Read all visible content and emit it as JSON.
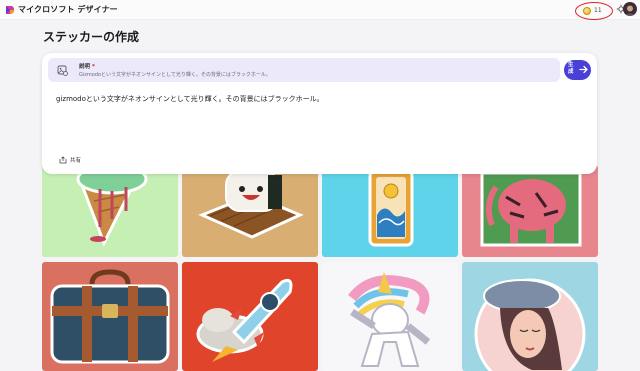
{
  "app": {
    "title": "マイクロソフト デザイナー"
  },
  "header": {
    "coin_count": "11"
  },
  "page": {
    "title": "ステッカーの作成"
  },
  "description": {
    "label": "説明",
    "required_mark": "*",
    "preview": "Gizmodoという文字がネオンサインとして光り輝く。その背景にはブラックホール。",
    "prompt": "gizmodoという文字がネオンサインとして光り輝く。その背景にはブラックホール。"
  },
  "generate_button": {
    "label": "生成"
  },
  "share": {
    "label": "共有"
  },
  "gallery": [
    {
      "icon": "ice-cream-sticker",
      "bg": "#c6f0b3"
    },
    {
      "icon": "sushi-sticker",
      "bg": "#d8ae72"
    },
    {
      "icon": "tarot-card-sticker",
      "bg": "#5fd3ea"
    },
    {
      "icon": "tiger-sticker",
      "bg": "#e8868e"
    },
    {
      "icon": "suitcase-sticker",
      "bg": "#d97060"
    },
    {
      "icon": "rocket-sticker",
      "bg": "#e0452b"
    },
    {
      "icon": "unicorn-sticker",
      "bg": "#f7f7f9"
    },
    {
      "icon": "woman-beret-sticker",
      "bg": "#9fd6e3"
    }
  ]
}
